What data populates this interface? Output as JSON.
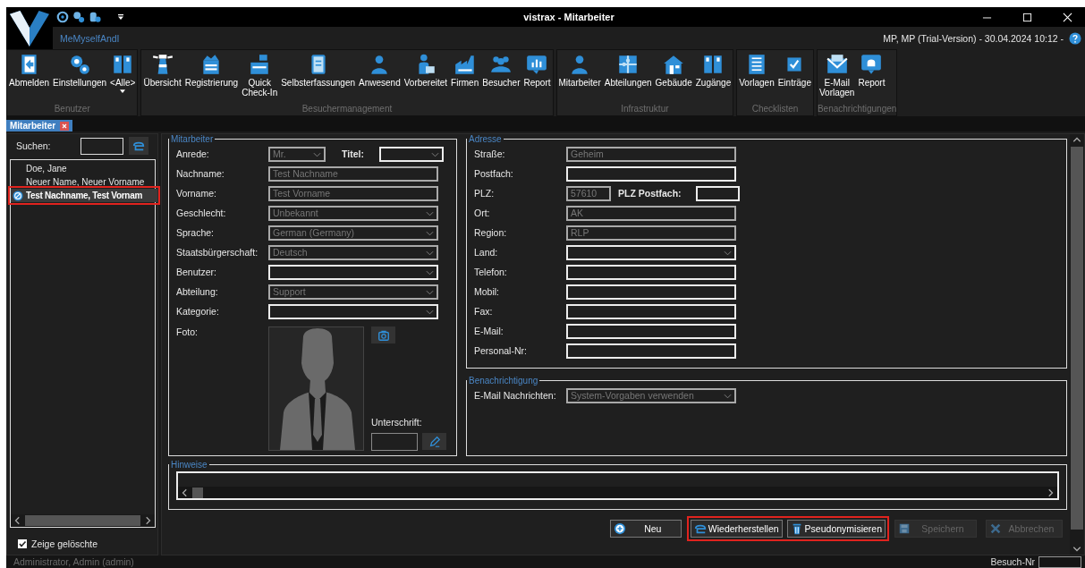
{
  "window": {
    "title": "vistrax - Mitarbeiter",
    "user_label": "MeMyselfAndI",
    "info": "MP, MP (Trial-Version) - 30.04.2024 10:12 -"
  },
  "ribbon": [
    {
      "group": "Benutzer",
      "buttons": [
        {
          "label": "Abmelden",
          "dropdown": false
        },
        {
          "label": "Einstellungen",
          "dropdown": false
        },
        {
          "label": "<Alle>",
          "dropdown": true
        }
      ]
    },
    {
      "group": "Besuchermanagement",
      "buttons": [
        {
          "label": "Übersicht",
          "dropdown": false
        },
        {
          "label": "Registrierung",
          "dropdown": false
        },
        {
          "label": "Quick\nCheck-In",
          "dropdown": false
        },
        {
          "label": "Selbsterfassungen",
          "dropdown": false
        },
        {
          "label": "Anwesend",
          "dropdown": false
        },
        {
          "label": "Vorbereitet",
          "dropdown": false
        },
        {
          "label": "Firmen",
          "dropdown": false
        },
        {
          "label": "Besucher",
          "dropdown": false
        },
        {
          "label": "Report",
          "dropdown": false
        }
      ]
    },
    {
      "group": "Infrastruktur",
      "buttons": [
        {
          "label": "Mitarbeiter",
          "dropdown": false
        },
        {
          "label": "Abteilungen",
          "dropdown": false
        },
        {
          "label": "Gebäude",
          "dropdown": false
        },
        {
          "label": "Zugänge",
          "dropdown": false
        }
      ]
    },
    {
      "group": "Checklisten",
      "buttons": [
        {
          "label": "Vorlagen",
          "dropdown": false
        },
        {
          "label": "Einträge",
          "dropdown": false
        }
      ]
    },
    {
      "group": "Benachrichtigungen",
      "buttons": [
        {
          "label": "E-Mail\nVorlagen",
          "dropdown": false
        },
        {
          "label": "Report",
          "dropdown": false
        }
      ]
    }
  ],
  "tabs": [
    {
      "label": "Mitarbeiter",
      "selected": true
    }
  ],
  "search": {
    "label": "Suchen:"
  },
  "list": [
    {
      "label": "Doe, Jane",
      "selected": false,
      "deleted": false,
      "highlighted": false
    },
    {
      "label": "Neuer Name, Neuer Vorname",
      "selected": false,
      "deleted": false,
      "highlighted": false
    },
    {
      "label": "Test Nachname, Test Vornam",
      "selected": true,
      "deleted": true,
      "highlighted": true
    }
  ],
  "show_deleted": {
    "label": "Zeige gelöschte",
    "checked": true
  },
  "employee": {
    "legend": "Mitarbeiter",
    "fields": [
      {
        "label": "Anrede:",
        "kind": "select",
        "value": "Mr.",
        "disabled": true,
        "companion": {
          "label": "Titel:",
          "kind": "select",
          "disabled": false
        }
      },
      {
        "label": "Nachname:",
        "kind": "input",
        "value": "Test Nachname",
        "disabled": true
      },
      {
        "label": "Vorname:",
        "kind": "input",
        "value": "Test Vorname",
        "disabled": true
      },
      {
        "label": "Geschlecht:",
        "kind": "select",
        "value": "Unbekannt",
        "disabled": true
      },
      {
        "label": "Sprache:",
        "kind": "select",
        "value": "German (Germany)",
        "disabled": true
      },
      {
        "label": "Staatsbürgerschaft:",
        "kind": "select",
        "value": "Deutsch",
        "disabled": true
      },
      {
        "label": "Benutzer:",
        "kind": "select",
        "disabled": false
      },
      {
        "label": "Abteilung:",
        "kind": "select",
        "value": "Support",
        "disabled": true
      },
      {
        "label": "Kategorie:",
        "kind": "select",
        "disabled": false
      }
    ],
    "photo": {
      "label": "Foto:",
      "signature_label": "Unterschrift:"
    }
  },
  "address": {
    "legend": "Adresse",
    "fields": [
      {
        "label": "Straße:",
        "kind": "input",
        "value": "Geheim",
        "disabled": true
      },
      {
        "label": "Postfach:",
        "kind": "input",
        "disabled": false
      },
      {
        "label": "PLZ:",
        "kind": "input",
        "value": "57610",
        "disabled": true,
        "companion": {
          "label": "PLZ Postfach:",
          "kind": "input",
          "disabled": false
        }
      },
      {
        "label": "Ort:",
        "kind": "input",
        "value": "AK",
        "disabled": true
      },
      {
        "label": "Region:",
        "kind": "input",
        "value": "RLP",
        "disabled": true
      },
      {
        "label": "Land:",
        "kind": "select",
        "disabled": false
      },
      {
        "label": "Telefon:",
        "kind": "input",
        "disabled": false
      },
      {
        "label": "Mobil:",
        "kind": "input",
        "disabled": false
      },
      {
        "label": "Fax:",
        "kind": "input",
        "disabled": false
      },
      {
        "label": "E-Mail:",
        "kind": "input",
        "disabled": false
      },
      {
        "label": "Personal-Nr:",
        "kind": "input",
        "disabled": false
      }
    ]
  },
  "notification": {
    "legend": "Benachrichtigung",
    "fields": [
      {
        "label": "E-Mail Nachrichten:",
        "kind": "select",
        "value": "System-Vorgaben verwenden",
        "disabled": true
      }
    ]
  },
  "notes": {
    "legend": "Hinweise"
  },
  "actions": [
    {
      "label": "Neu",
      "disabled": false,
      "highlighted": false
    },
    {
      "label": "Wiederherstellen",
      "disabled": false,
      "highlighted": true
    },
    {
      "label": "Pseudonymisieren",
      "disabled": false,
      "highlighted": true
    },
    {
      "label": "Speichern",
      "disabled": true,
      "highlighted": false
    },
    {
      "label": "Abbrechen",
      "disabled": true,
      "highlighted": false
    }
  ],
  "status_bar": {
    "user": "Administrator, Admin (admin)",
    "visit_label": "Besuch-Nr"
  }
}
